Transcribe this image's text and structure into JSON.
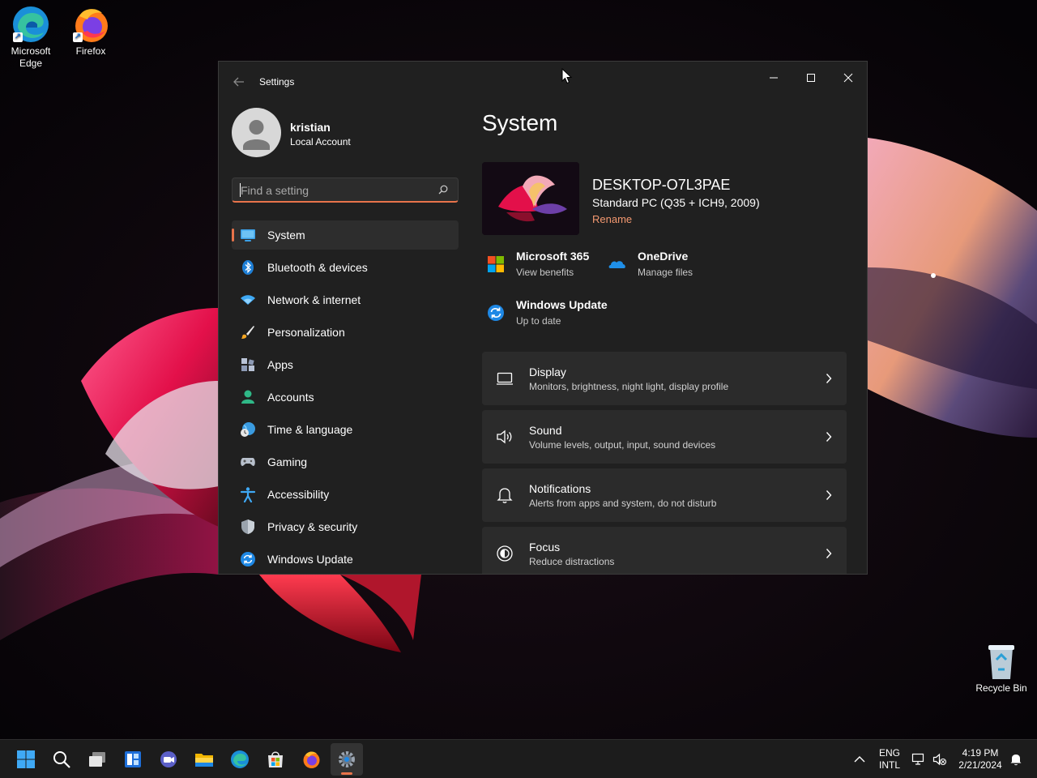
{
  "desktop": {
    "icons": [
      {
        "label_line1": "Microsoft",
        "label_line2": "Edge",
        "icon": "edge-icon"
      },
      {
        "label_line1": "Firefox",
        "label_line2": "",
        "icon": "firefox-icon"
      },
      {
        "label_line1": "Recycle Bin",
        "label_line2": "",
        "icon": "recycle-bin-icon"
      }
    ]
  },
  "window": {
    "title": "Settings",
    "controls": [
      "minimize",
      "maximize",
      "close"
    ]
  },
  "user": {
    "name": "kristian",
    "account_type": "Local Account"
  },
  "search": {
    "placeholder": "Find a setting",
    "value": ""
  },
  "nav": {
    "items": [
      {
        "label": "System",
        "icon": "monitor-icon",
        "active": true
      },
      {
        "label": "Bluetooth & devices",
        "icon": "bluetooth-icon"
      },
      {
        "label": "Network & internet",
        "icon": "wifi-icon"
      },
      {
        "label": "Personalization",
        "icon": "brush-icon"
      },
      {
        "label": "Apps",
        "icon": "apps-icon"
      },
      {
        "label": "Accounts",
        "icon": "person-icon"
      },
      {
        "label": "Time & language",
        "icon": "globe-clock-icon"
      },
      {
        "label": "Gaming",
        "icon": "gamepad-icon"
      },
      {
        "label": "Accessibility",
        "icon": "accessibility-icon"
      },
      {
        "label": "Privacy & security",
        "icon": "shield-icon"
      },
      {
        "label": "Windows Update",
        "icon": "update-icon"
      }
    ]
  },
  "main": {
    "title": "System",
    "device": {
      "name": "DESKTOP-O7L3PAE",
      "model": "Standard PC (Q35 + ICH9, 2009)",
      "rename_label": "Rename"
    },
    "quick_links": [
      {
        "title": "Microsoft 365",
        "subtitle": "View benefits",
        "icon": "microsoft-logo-icon"
      },
      {
        "title": "OneDrive",
        "subtitle": "Manage files",
        "icon": "onedrive-cloud-icon"
      },
      {
        "title": "Windows Update",
        "subtitle": "Up to date",
        "icon": "update-icon"
      }
    ],
    "cards": [
      {
        "title": "Display",
        "description": "Monitors, brightness, night light, display profile",
        "icon": "display-icon"
      },
      {
        "title": "Sound",
        "description": "Volume levels, output, input, sound devices",
        "icon": "speaker-icon"
      },
      {
        "title": "Notifications",
        "description": "Alerts from apps and system, do not disturb",
        "icon": "bell-icon"
      },
      {
        "title": "Focus",
        "description": "Reduce distractions",
        "icon": "focus-icon"
      }
    ]
  },
  "taskbar": {
    "apps": [
      "start",
      "search",
      "task-view",
      "widgets",
      "teams-chat",
      "file-explorer",
      "edge",
      "store",
      "firefox",
      "settings"
    ],
    "active_app": "settings",
    "tray": {
      "language_line1": "ENG",
      "language_line2": "INTL",
      "time": "4:19 PM",
      "date": "2/21/2024"
    }
  },
  "colors": {
    "accent": "#e8734a",
    "window_bg": "#202020",
    "card_bg": "#2b2b2b",
    "link": "#f39870"
  }
}
